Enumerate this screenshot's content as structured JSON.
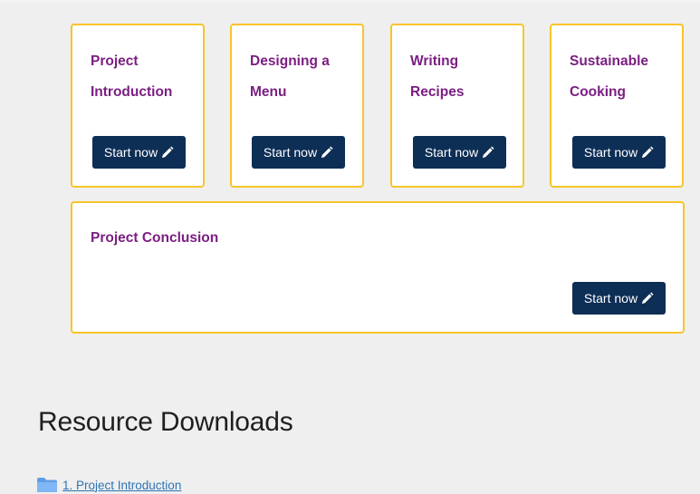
{
  "cards": [
    {
      "title": "Project Introduction",
      "button_label": "Start now"
    },
    {
      "title": "Designing a Menu",
      "button_label": "Start now"
    },
    {
      "title": "Writing Recipes",
      "button_label": "Start now"
    },
    {
      "title": "Sustainable Cooking",
      "button_label": "Start now"
    }
  ],
  "conclusion_card": {
    "title": "Project Conclusion",
    "button_label": "Start now"
  },
  "resources": {
    "heading": "Resource Downloads",
    "items": [
      {
        "label": "1. Project Introduction"
      }
    ]
  },
  "colors": {
    "card_border": "#f7c52a",
    "title": "#7b1f82",
    "button_bg": "#0d2e55",
    "link": "#2d73b4",
    "page_bg": "#efefef"
  },
  "icons": {
    "button": "pencil-icon",
    "resource": "folder-icon"
  }
}
